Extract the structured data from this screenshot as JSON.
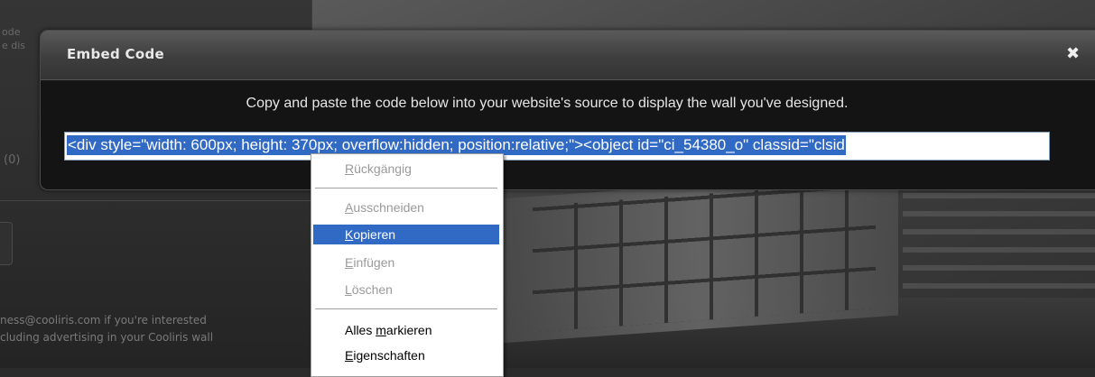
{
  "background": {
    "left_panel_snippet": [
      "ode",
      "e dis"
    ],
    "left_panel_count": "(0)",
    "footer_lines": [
      "ness@cooliris.com if you're interested",
      "cluding advertising in your Cooliris wall"
    ]
  },
  "modal": {
    "title": "Embed Code",
    "close_glyph": "✖",
    "instruction": "Copy and paste the code below into your website's source to display the wall you've designed.",
    "code_value": "<div style=\"width: 600px; height: 370px; overflow:hidden; position:relative;\"><object id=\"ci_54380_o\" classid=\"clsid"
  },
  "context_menu": {
    "items": [
      {
        "pre": "",
        "key": "R",
        "post": "ückgängig",
        "state": "disabled"
      },
      {
        "pre": "",
        "key": "A",
        "post": "usschneiden",
        "state": "disabled"
      },
      {
        "pre": "",
        "key": "K",
        "post": "opieren",
        "state": "hover"
      },
      {
        "pre": "",
        "key": "E",
        "post": "infügen",
        "state": "disabled"
      },
      {
        "pre": "",
        "key": "L",
        "post": "öschen",
        "state": "disabled"
      },
      {
        "pre": "Alles ",
        "key": "m",
        "post": "arkieren",
        "state": "enabled"
      },
      {
        "pre": "",
        "key": "E",
        "post": "igenschaften",
        "state": "enabled"
      }
    ]
  },
  "colors": {
    "selection": "#316ac5",
    "modal_bg": "#141414",
    "header_gradient_top": "#5a5a5a"
  }
}
